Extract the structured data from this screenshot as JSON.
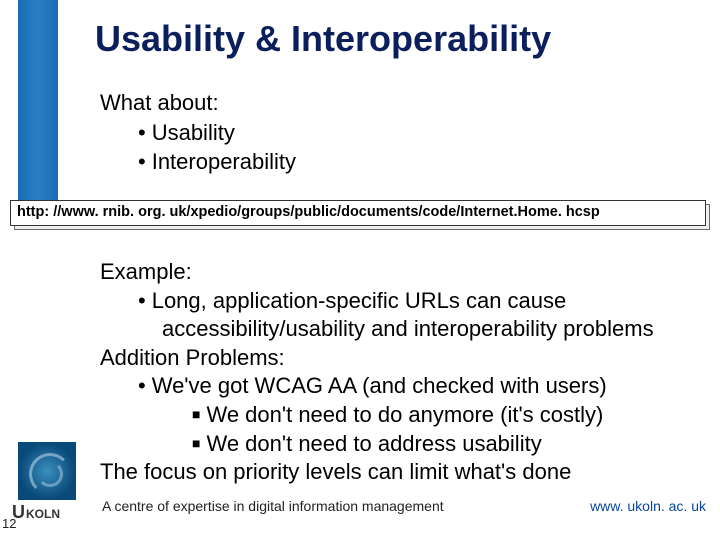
{
  "title": "Usability & Interoperability",
  "intro": {
    "lead": "What about:",
    "b1": "Usability",
    "b2": "Interoperability"
  },
  "url_box": "http: //www. rnib. org. uk/xpedio/groups/public/documents/code/Internet.Home. hcsp",
  "example": {
    "lead": "Example:",
    "b1a": "Long, application-specific URLs can cause",
    "b1b": "accessibility/usability and interoperability problems",
    "lead2": "Addition Problems:",
    "b2": "We've got WCAG AA (and checked with users)",
    "s1": "We don't need to do anymore (it's costly)",
    "s2": "We don't need to address usability",
    "tail": "The focus on priority levels can limit what's done"
  },
  "footer": {
    "tagline": "A centre of expertise in digital information management",
    "url": "www. ukoln. ac. uk",
    "logo_text": "UKOLN"
  },
  "page_num": "12"
}
